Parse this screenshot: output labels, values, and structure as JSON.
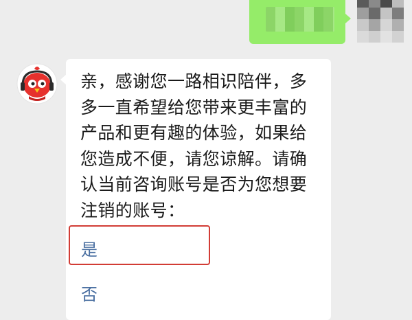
{
  "chat": {
    "message": "亲，感谢您一路相识陪伴，多多一直希望给您带来更丰富的产品和更有趣的体验，如果给您造成不便，请您谅解。请确认当前咨询账号是否为您想要注销的账号：",
    "options": [
      {
        "label": "是"
      },
      {
        "label": "否"
      }
    ]
  },
  "colors": {
    "background": "#ededed",
    "outgoing_bubble": "#95ec69",
    "incoming_bubble": "#ffffff",
    "option_text": "#4a6fa1",
    "highlight_border": "#d23c35",
    "avatar_red": "#e6312d"
  }
}
